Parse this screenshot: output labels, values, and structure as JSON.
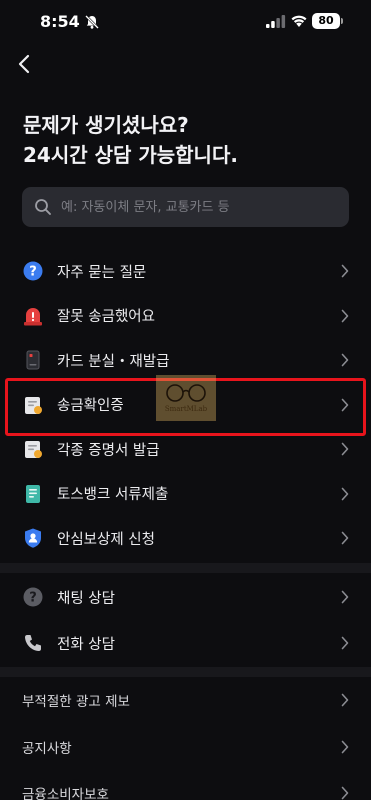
{
  "status_bar": {
    "time": "8:54",
    "battery": "80"
  },
  "header": {
    "title_line1": "문제가 생기셨나요?",
    "title_line2": "24시간 상담 가능합니다."
  },
  "search": {
    "placeholder": "예: 자동이체 문자, 교통카드 등"
  },
  "menu1": [
    {
      "label": "자주 묻는 질문",
      "icon": "question-circle-icon"
    },
    {
      "label": "잘못 송금했어요",
      "icon": "siren-icon"
    },
    {
      "label": "카드 분실・재발급",
      "icon": "card-icon"
    },
    {
      "label": "송금확인증",
      "icon": "certificate-icon"
    },
    {
      "label": "각종 증명서 발급",
      "icon": "document-icon"
    },
    {
      "label": "토스뱅크 서류제출",
      "icon": "paper-icon"
    },
    {
      "label": "안심보상제 신청",
      "icon": "shield-user-icon"
    }
  ],
  "menu2": [
    {
      "label": "채팅 상담",
      "icon": "chat-question-icon"
    },
    {
      "label": "전화 상담",
      "icon": "phone-icon"
    }
  ],
  "menu3": [
    {
      "label": "부적절한 광고 제보"
    },
    {
      "label": "공지사항"
    },
    {
      "label": "금융소비자보호"
    }
  ],
  "watermark": {
    "text": "SmartMLab"
  },
  "colors": {
    "background": "#0d0d10",
    "search_bg": "#2a2b31",
    "highlight": "#e8141c",
    "accent_blue": "#3b7cf0",
    "alert_red": "#e5403f"
  }
}
